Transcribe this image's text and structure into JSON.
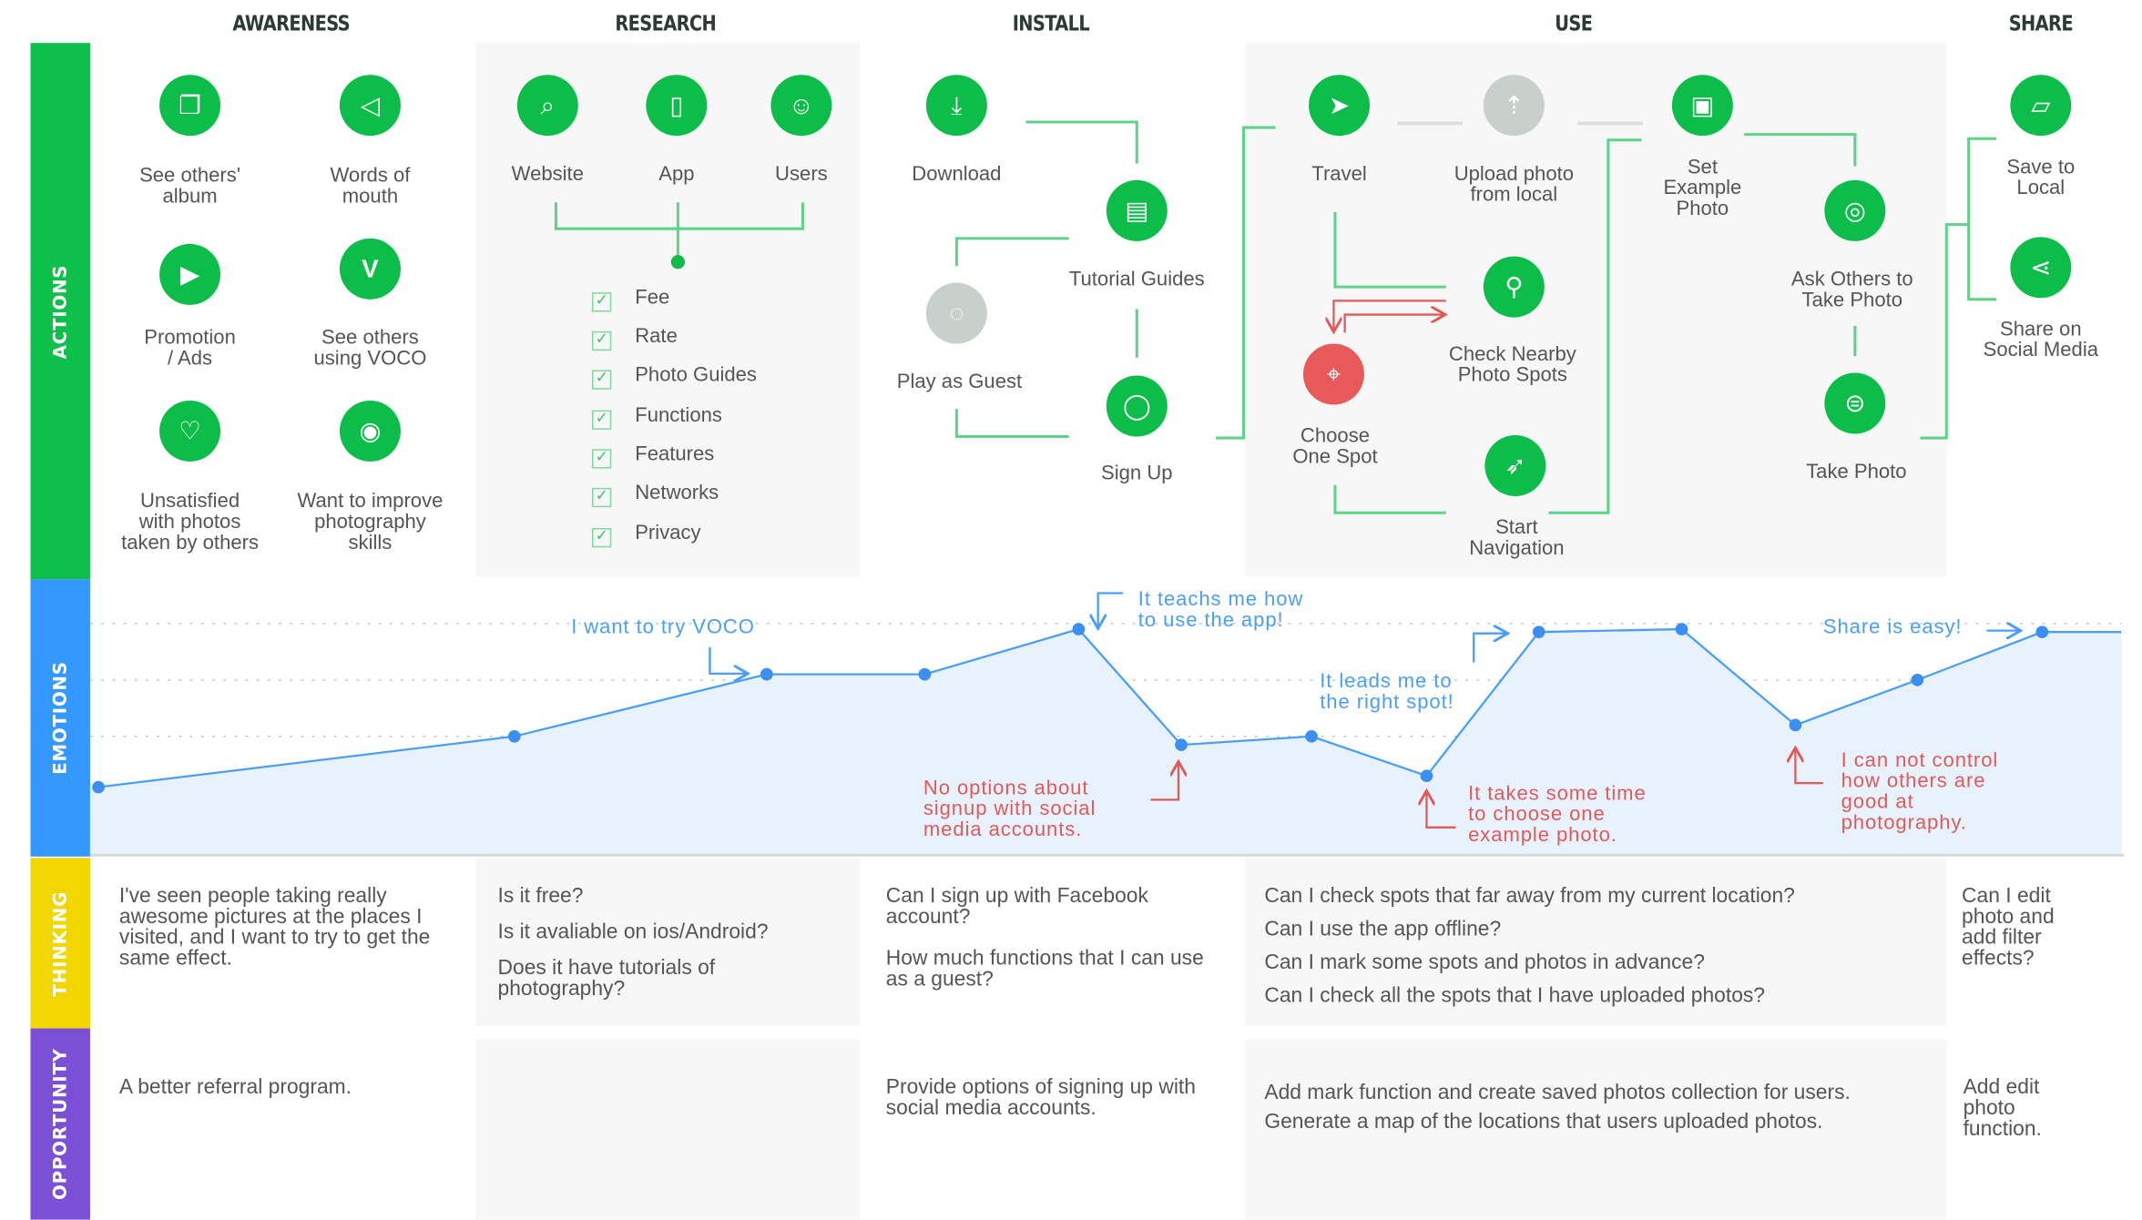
{
  "stages": [
    "AWARENESS",
    "RESEARCH",
    "INSTALL",
    "USE",
    "SHARE"
  ],
  "rows": {
    "actions": "ACTIONS",
    "emotions": "EMOTIONS",
    "thinking": "THINKING",
    "opportunity": "OPPORTUNITY"
  },
  "colors": {
    "actions": "#0cc04a",
    "emotions": "#3399ff",
    "thinking": "#f2d600",
    "opportunity": "#7b4fd6",
    "node": "#0dbd4a",
    "node_inactive": "#c9cfcb",
    "node_alert": "#e85a5a",
    "line_positive": "#4a9ff5",
    "line_negative": "#e05a5a"
  },
  "actions": {
    "awareness": [
      {
        "label": "See others'\nalbum",
        "icon": "photos-icon"
      },
      {
        "label": "Words of\nmouth",
        "icon": "megaphone-icon"
      },
      {
        "label": "Promotion\n/ Ads",
        "icon": "film-icon"
      },
      {
        "label": "See others\nusing VOCO",
        "icon": "voco-logo-icon",
        "glyph": "V"
      },
      {
        "label": "Unsatisfied\nwith photos\ntaken by others",
        "icon": "broken-heart-icon"
      },
      {
        "label": "Want to improve\nphotography\nskills",
        "icon": "camera-icon"
      }
    ],
    "research": {
      "sources": [
        {
          "label": "Website",
          "icon": "browser-search-icon"
        },
        {
          "label": "App",
          "icon": "phone-icon"
        },
        {
          "label": "Users",
          "icon": "users-icon"
        }
      ],
      "checklist": [
        "Fee",
        "Rate",
        "Photo Guides",
        "Functions",
        "Features",
        "Networks",
        "Privacy"
      ]
    },
    "install": [
      {
        "label": "Download",
        "icon": "download-icon"
      },
      {
        "label": "Tutorial Guides",
        "icon": "document-icon"
      },
      {
        "label": "Play as Guest",
        "icon": "guest-user-icon"
      },
      {
        "label": "Sign Up",
        "icon": "user-icon"
      }
    ],
    "use": [
      {
        "label": "Travel",
        "icon": "paper-plane-icon"
      },
      {
        "label": "Upload photo\nfrom local",
        "icon": "upload-folder-icon"
      },
      {
        "label": "Set\nExample\nPhoto",
        "icon": "image-icon"
      },
      {
        "label": "Check Nearby\nPhoto Spots",
        "icon": "map-pins-icon"
      },
      {
        "label": "Choose\nOne Spot",
        "icon": "location-pin-icon"
      },
      {
        "label": "Start\nNavigation",
        "icon": "navigation-icon"
      },
      {
        "label": "Ask Others to\nTake Photo",
        "icon": "eye-icon"
      },
      {
        "label": "Take Photo",
        "icon": "shutter-icon"
      }
    ],
    "share": [
      {
        "label": "Save to\nLocal",
        "icon": "folder-icon"
      },
      {
        "label": "Share on\nSocial Media",
        "icon": "share-icon"
      }
    ]
  },
  "emotions": {
    "annotations_positive": [
      "I want to try VOCO",
      "It teachs me how\nto use the app!",
      "It leads me to\nthe right spot!",
      "Share is easy!"
    ],
    "annotations_negative": [
      "No options about\nsignup with social\nmedia accounts.",
      "It takes some time\nto choose one\nexample photo.",
      "I can not control\nhow others are\ngood at\nphotography."
    ]
  },
  "chart_data": {
    "type": "line",
    "title": "",
    "xlabel": "",
    "ylabel": "",
    "ylim": [
      0.5,
      4.5
    ],
    "grid": true,
    "values": [
      1.1,
      2.0,
      3.1,
      3.1,
      3.9,
      1.85,
      2.0,
      1.3,
      3.85,
      3.9,
      2.2,
      3.0,
      3.85,
      3.85
    ]
  },
  "thinking": {
    "awareness": [
      "I've seen people taking really awesome pictures at the places I visited, and I want to try to get the same effect."
    ],
    "research": [
      "Is it free?",
      "Is it avaliable on ios/Android?",
      "Does it have tutorials of photography?"
    ],
    "install": [
      "Can I sign up with Facebook account?",
      "How much functions that I can use as a guest?"
    ],
    "use": [
      "Can I check spots that far away from my current location?",
      "Can I use the app offline?",
      "Can I mark some spots and photos in advance?",
      "Can I check all the spots that I have uploaded photos?"
    ],
    "share": [
      "Can I edit photo and add filter effects?"
    ]
  },
  "opportunity": {
    "awareness": [
      "A better referral program."
    ],
    "research": [],
    "install": [
      "Provide options of signing up with social media accounts."
    ],
    "use": [
      "Add mark function and create saved photos collection for users.",
      "Generate a map of the locations that users uploaded photos."
    ],
    "share": [
      "Add edit photo function."
    ]
  }
}
